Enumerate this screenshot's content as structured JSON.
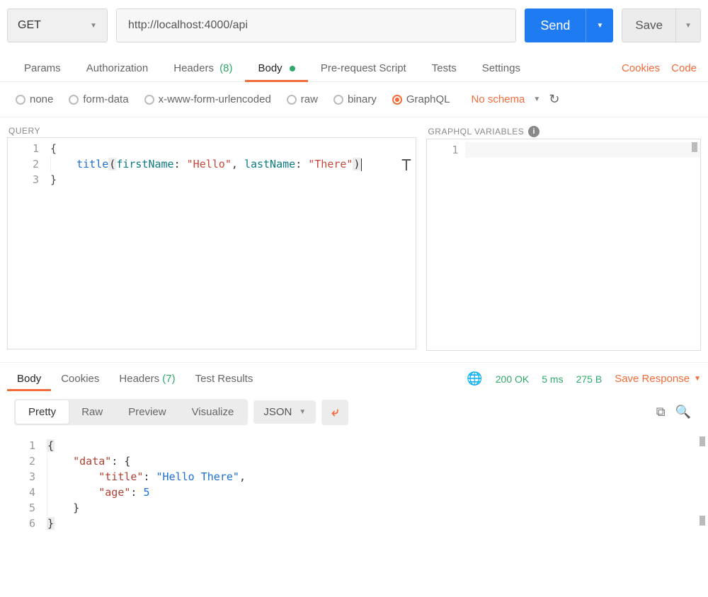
{
  "request": {
    "method": "GET",
    "url": "http://localhost:4000/api",
    "send_label": "Send",
    "save_label": "Save"
  },
  "tabs": {
    "params": "Params",
    "authorization": "Authorization",
    "headers": "Headers",
    "headers_count": "(8)",
    "body": "Body",
    "prerequest": "Pre-request Script",
    "tests": "Tests",
    "settings": "Settings",
    "cookies_link": "Cookies",
    "code_link": "Code"
  },
  "body_types": {
    "none": "none",
    "formdata": "form-data",
    "urlencoded": "x-www-form-urlencoded",
    "raw": "raw",
    "binary": "binary",
    "graphql": "GraphQL",
    "schema_text": "No schema"
  },
  "query_panel": {
    "title": "QUERY",
    "lines": [
      "1",
      "2",
      "3"
    ],
    "code": {
      "l1": "{",
      "l2_indent": "    ",
      "l2_field": "title",
      "l2_open": "(",
      "l2_arg1": "firstName",
      "l2_colon1": ": ",
      "l2_val1": "\"Hello\"",
      "l2_comma": ", ",
      "l2_arg2": "lastName",
      "l2_colon2": ": ",
      "l2_val2": "\"There\"",
      "l2_close": ")",
      "l3": "}"
    }
  },
  "vars_panel": {
    "title": "GRAPHQL VARIABLES",
    "lines": [
      "1"
    ]
  },
  "response_tabs": {
    "body": "Body",
    "cookies": "Cookies",
    "headers": "Headers",
    "headers_count": "(7)",
    "test_results": "Test Results"
  },
  "status": {
    "code": "200 OK",
    "time": "5 ms",
    "size": "275 B",
    "save_response": "Save Response"
  },
  "view": {
    "pretty": "Pretty",
    "raw": "Raw",
    "preview": "Preview",
    "visualize": "Visualize",
    "format": "JSON"
  },
  "response_body": {
    "lines": [
      "1",
      "2",
      "3",
      "4",
      "5",
      "6"
    ],
    "code": {
      "l1": "{",
      "l2_indent": "    ",
      "l2_key": "\"data\"",
      "l2_rest": ": {",
      "l3_indent": "        ",
      "l3_key": "\"title\"",
      "l3_colon": ": ",
      "l3_val": "\"Hello There\"",
      "l3_comma": ",",
      "l4_indent": "        ",
      "l4_key": "\"age\"",
      "l4_colon": ": ",
      "l4_val": "5",
      "l5_indent": "    ",
      "l5": "}",
      "l6": "}"
    }
  }
}
